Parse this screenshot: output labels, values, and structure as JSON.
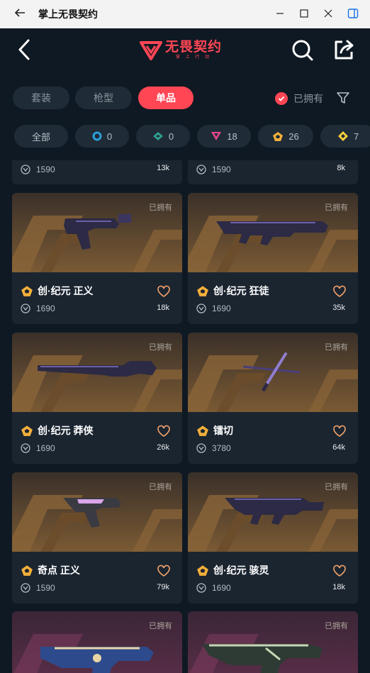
{
  "window": {
    "title": "掌上无畏契约"
  },
  "logo": {
    "main": "无畏契约",
    "sub": "掌 上 行 动"
  },
  "tabs": [
    {
      "label": "套装"
    },
    {
      "label": "枪型"
    },
    {
      "label": "单品"
    }
  ],
  "owned_filter": {
    "label": "已拥有"
  },
  "chips": [
    {
      "label": "全部",
      "count": ""
    },
    {
      "label": "",
      "count": "0",
      "icon": "blue-ring-tier-icon",
      "color": "#2b9fd6"
    },
    {
      "label": "",
      "count": "0",
      "icon": "teal-diamond-tier-icon",
      "color": "#2f9e8f"
    },
    {
      "label": "",
      "count": "18",
      "icon": "pink-triangle-tier-icon",
      "color": "#e8478e"
    },
    {
      "label": "",
      "count": "26",
      "icon": "orange-pentagon-tier-icon",
      "color": "#f4b03a"
    },
    {
      "label": "",
      "count": "7",
      "icon": "yellow-diamond-tier-icon",
      "color": "#f6d03c"
    }
  ],
  "partial_row": [
    {
      "price": "1590",
      "likes": "13k"
    },
    {
      "price": "1590",
      "likes": "8k"
    }
  ],
  "cards": [
    {
      "name": "创·纪元 正义",
      "price": "1690",
      "likes": "18k",
      "owned": "已拥有"
    },
    {
      "name": "创·纪元 狂徒",
      "price": "1690",
      "likes": "35k",
      "owned": "已拥有"
    },
    {
      "name": "创·纪元 莽侠",
      "price": "1690",
      "likes": "26k",
      "owned": "已拥有"
    },
    {
      "name": "镭切",
      "price": "3780",
      "likes": "64k",
      "owned": "已拥有"
    },
    {
      "name": "奇点 正义",
      "price": "1590",
      "likes": "79k",
      "owned": "已拥有"
    },
    {
      "name": "创·纪元 骇灵",
      "price": "1690",
      "likes": "18k",
      "owned": "已拥有"
    }
  ],
  "bottom_row": [
    {
      "owned": "已拥有"
    },
    {
      "owned": "已拥有"
    }
  ],
  "colors": {
    "accent": "#ff4655",
    "background": "#0f1923",
    "card": "#1b2530"
  }
}
